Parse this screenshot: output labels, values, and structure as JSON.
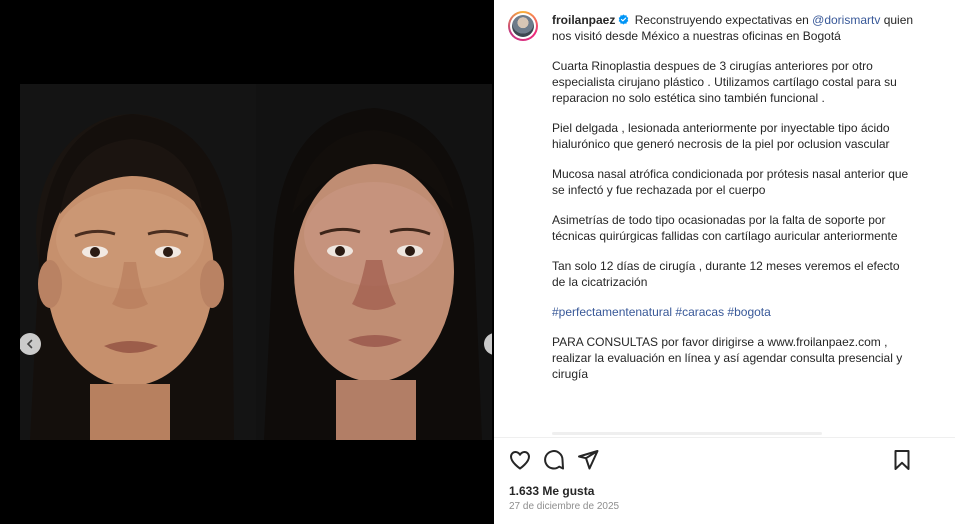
{
  "media": {
    "carousel": {
      "prev_icon": "chevron-left-icon",
      "next_icon": "chevron-right-icon"
    }
  },
  "post": {
    "author": {
      "username": "froilanpaez",
      "verified": true,
      "verified_icon": "verified-badge-icon"
    },
    "caption": {
      "intro": "Reconstruyendo expectativas en",
      "mention": "@dorismartv",
      "intro_rest": "quien nos visitó desde México a nuestras oficinas en Bogotá",
      "paragraphs": [
        "Cuarta Rinoplastia despues de 3 cirugías anteriores por otro especialista cirujano plástico . Utilizamos cartílago costal para su reparacion no solo estética sino también funcional .",
        "Piel delgada , lesionada anteriormente por inyectable tipo ácido hialurónico que generó necrosis de la piel por oclusion vascular",
        "Mucosa nasal atrófica condicionada por prótesis nasal anterior que se infectó y fue rechazada por el cuerpo",
        "Asimetrías de todo tipo ocasionadas por la falta de soporte por técnicas quirúrgicas fallidas con cartílago auricular anteriormente",
        "Tan solo 12 días de cirugía , durante 12 meses veremos el efecto de la cicatrización"
      ],
      "hashtags": "#perfectamentenatural #caracas #bogota",
      "contact": "PARA CONSULTAS por favor dirigirse a www.froilanpaez.com , realizar la evaluación en línea y así agendar consulta presencial y cirugía"
    },
    "actions": {
      "like_icon": "heart-icon",
      "comment_icon": "comment-icon",
      "share_icon": "send-icon",
      "save_icon": "bookmark-icon"
    },
    "likes": {
      "count": "1.633",
      "label": "Me gusta"
    },
    "date": "27 de diciembre de 2025"
  },
  "colors": {
    "link": "#385898",
    "muted": "#8e8e8e",
    "text": "#262626",
    "verified": "#0095f6"
  }
}
